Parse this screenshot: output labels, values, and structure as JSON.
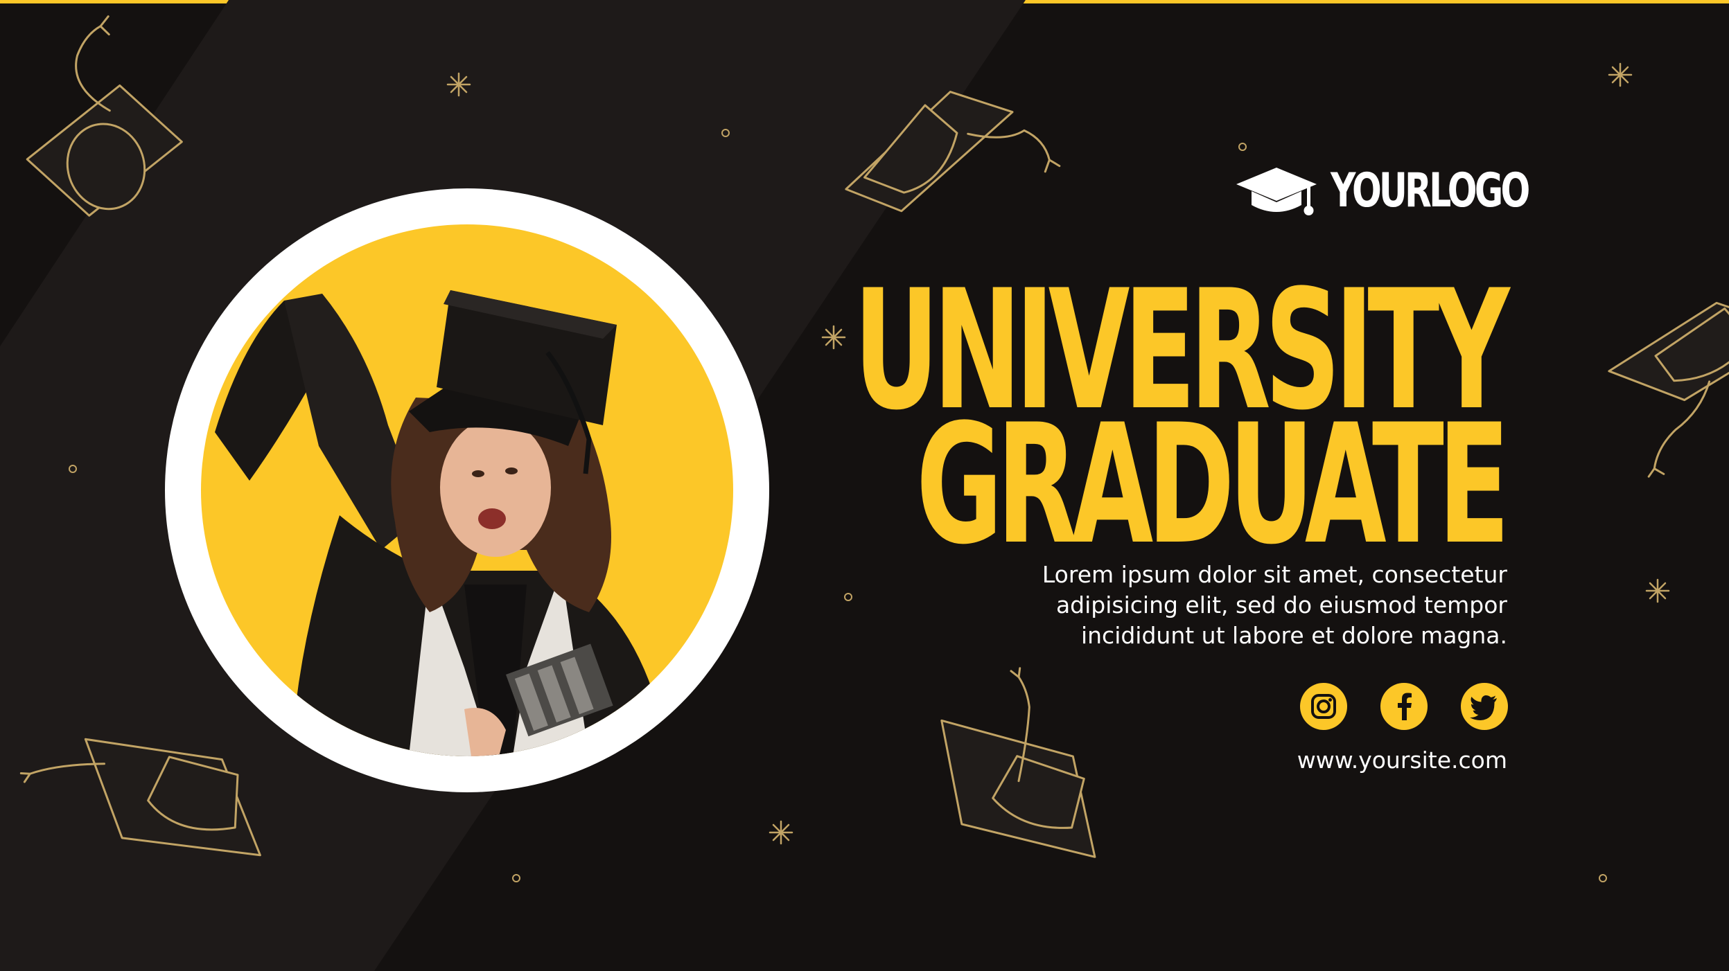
{
  "brand": {
    "logo_text": "YOURLOGO",
    "logo_icon": "graduation-cap-icon"
  },
  "title": {
    "line1": "UNIVERSITY",
    "line2": "GRADUATE"
  },
  "description": {
    "line1": "Lorem ipsum dolor sit amet, consectetur",
    "line2": "adipisicing elit, sed do eiusmod tempor",
    "line3": "incididunt ut labore et dolore magna."
  },
  "social": {
    "icons": [
      "instagram-icon",
      "facebook-icon",
      "twitter-icon"
    ]
  },
  "website": "www.yoursite.com",
  "colors": {
    "accent": "#fcc728",
    "background": "#141110",
    "background_band": "#1e1a19",
    "line_art": "#c2a465",
    "text_light": "#ffffff"
  }
}
